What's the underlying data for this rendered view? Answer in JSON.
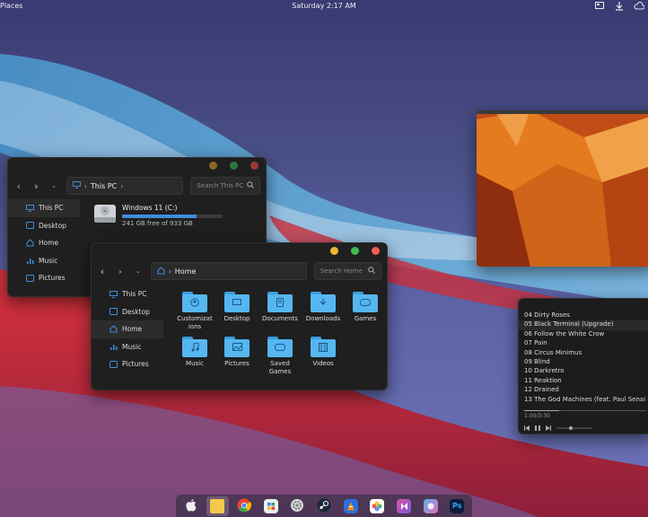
{
  "topbar": {
    "left_label": "Places",
    "clock": "Saturday 2:17 AM",
    "icons": [
      "display-icon",
      "download-icon",
      "cloud-icon"
    ]
  },
  "win1": {
    "path": "This PC",
    "search_placeholder": "Search This PC",
    "sidebar": [
      "This PC",
      "Desktop",
      "Home",
      "Music",
      "Pictures"
    ],
    "drive": {
      "name": "Windows 11 (C:)",
      "free": "241 GB free of 933 GB",
      "used_fraction": 0.74
    }
  },
  "win2": {
    "path": "Home",
    "search_placeholder": "Search Home",
    "sidebar": [
      "This PC",
      "Desktop",
      "Home",
      "Music",
      "Pictures"
    ],
    "folders": [
      "Customizations",
      "Desktop",
      "Documents",
      "Downloads",
      "Games",
      "Music",
      "Pictures",
      "Saved Games",
      "Videos"
    ]
  },
  "player": {
    "tracks": [
      "04  Dirty Roses",
      "05  Black Terminal (Upgrade)",
      "06  Follow the White Crow",
      "07  Pain",
      "08  Circus Minimus",
      "09  Blind",
      "10  Darkretro",
      "11  Reaktion",
      "12  Drained",
      "13  The God Machines (feat. Paul Senai &"
    ],
    "time": "1:00/3:30",
    "progress": 0.29
  },
  "dock": {
    "apps": [
      "apple",
      "files",
      "chrome",
      "app-store",
      "settings",
      "steam",
      "vlc",
      "photos",
      "kodi",
      "gimp",
      "photoshop"
    ],
    "ps_label": "Ps"
  },
  "colors": {
    "accent": "#3f8de0",
    "folder": "#56b6f0",
    "red": "#ee5d54",
    "yellow": "#e9b82e",
    "green": "#3fb950"
  }
}
